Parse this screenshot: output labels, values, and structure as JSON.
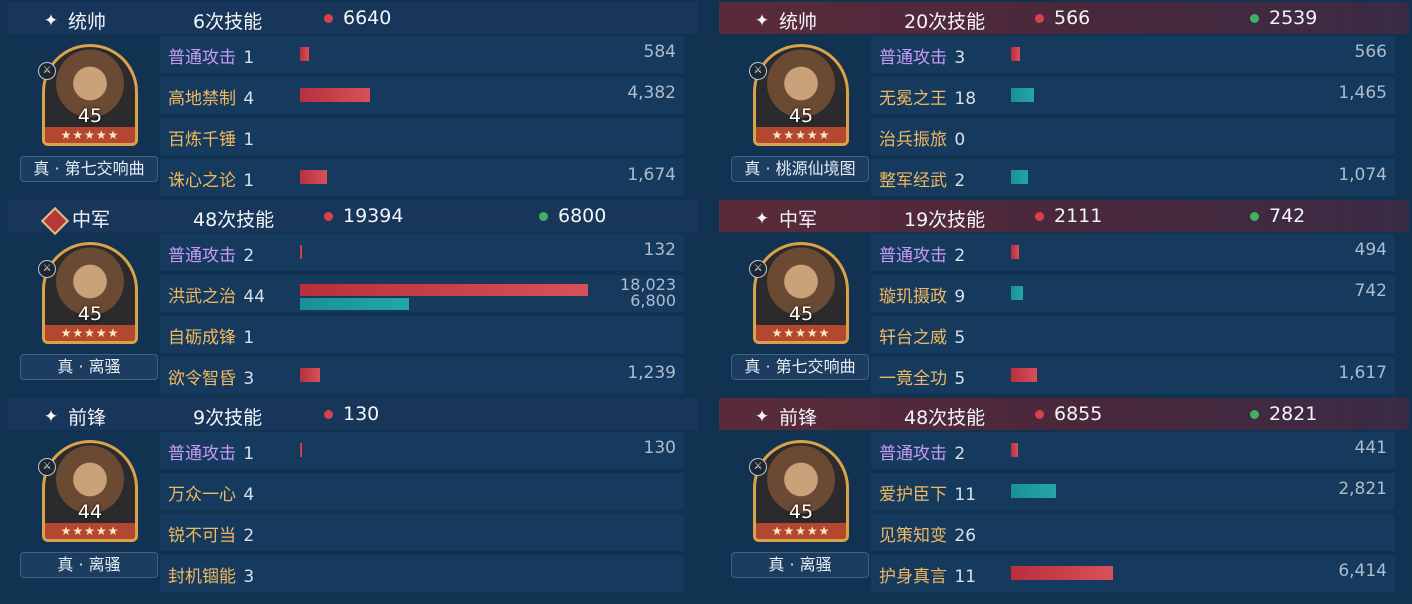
{
  "left": [
    {
      "role": "统帅",
      "role_icon": "sparkle-icon",
      "count": "6次技能",
      "damage": "6640",
      "heal": null,
      "level": "45",
      "stars": "★★★★★",
      "tactic": "真 · 第七交响曲",
      "skills": [
        {
          "name": "普通攻击",
          "level": "1",
          "basic": true,
          "dmg": 584,
          "heal": null,
          "label": "584"
        },
        {
          "name": "高地禁制",
          "level": "4",
          "basic": false,
          "dmg": 4382,
          "heal": null,
          "label": "4,382"
        },
        {
          "name": "百炼千锤",
          "level": "1",
          "basic": false,
          "dmg": null,
          "heal": null,
          "label": ""
        },
        {
          "name": "诛心之论",
          "level": "1",
          "basic": false,
          "dmg": 1674,
          "heal": null,
          "label": "1,674"
        }
      ]
    },
    {
      "role": "中军",
      "role_icon": "banner-diamond-icon",
      "count": "48次技能",
      "damage": "19394",
      "heal": "6800",
      "level": "45",
      "stars": "★★★★★",
      "tactic": "真 · 离骚",
      "skills": [
        {
          "name": "普通攻击",
          "level": "2",
          "basic": true,
          "dmg": 132,
          "heal": null,
          "label": "132"
        },
        {
          "name": "洪武之治",
          "level": "44",
          "basic": false,
          "dmg": 18023,
          "heal": 6800,
          "label": "18,023",
          "label2": "6,800"
        },
        {
          "name": "自砺成锋",
          "level": "1",
          "basic": false,
          "dmg": null,
          "heal": null,
          "label": ""
        },
        {
          "name": "欲令智昏",
          "level": "3",
          "basic": false,
          "dmg": 1239,
          "heal": null,
          "label": "1,239"
        }
      ]
    },
    {
      "role": "前锋",
      "role_icon": "sparkle-icon",
      "count": "9次技能",
      "damage": "130",
      "heal": null,
      "level": "44",
      "stars": "★★★★★",
      "tactic": "真 · 离骚",
      "skills": [
        {
          "name": "普通攻击",
          "level": "1",
          "basic": true,
          "dmg": 130,
          "heal": null,
          "label": "130"
        },
        {
          "name": "万众一心",
          "level": "4",
          "basic": false,
          "dmg": null,
          "heal": null,
          "label": ""
        },
        {
          "name": "锐不可当",
          "level": "2",
          "basic": false,
          "dmg": null,
          "heal": null,
          "label": ""
        },
        {
          "name": "封机锢能",
          "level": "3",
          "basic": false,
          "dmg": null,
          "heal": null,
          "label": ""
        }
      ]
    }
  ],
  "right": [
    {
      "role": "统帅",
      "role_icon": "sparkle-icon",
      "count": "20次技能",
      "damage": "566",
      "heal": "2539",
      "level": "45",
      "stars": "★★★★★",
      "tactic": "真 · 桃源仙境图",
      "skills": [
        {
          "name": "普通攻击",
          "level": "3",
          "basic": true,
          "dmg": 566,
          "heal": null,
          "label": "566"
        },
        {
          "name": "无冕之王",
          "level": "18",
          "basic": false,
          "dmg": null,
          "heal": 1465,
          "label": "1,465"
        },
        {
          "name": "治兵振旅",
          "level": "0",
          "basic": false,
          "dmg": null,
          "heal": null,
          "label": ""
        },
        {
          "name": "整军经武",
          "level": "2",
          "basic": false,
          "dmg": null,
          "heal": 1074,
          "label": "1,074"
        }
      ]
    },
    {
      "role": "中军",
      "role_icon": "sparkle-icon",
      "count": "19次技能",
      "damage": "2111",
      "heal": "742",
      "level": "45",
      "stars": "★★★★★",
      "tactic": "真 · 第七交响曲",
      "skills": [
        {
          "name": "普通攻击",
          "level": "2",
          "basic": true,
          "dmg": 494,
          "heal": null,
          "label": "494"
        },
        {
          "name": "璇玑摄政",
          "level": "9",
          "basic": false,
          "dmg": null,
          "heal": 742,
          "label": "742"
        },
        {
          "name": "轩台之威",
          "level": "5",
          "basic": false,
          "dmg": null,
          "heal": null,
          "label": ""
        },
        {
          "name": "一竟全功",
          "level": "5",
          "basic": false,
          "dmg": 1617,
          "heal": null,
          "label": "1,617"
        }
      ]
    },
    {
      "role": "前锋",
      "role_icon": "sparkle-icon",
      "count": "48次技能",
      "damage": "6855",
      "heal": "2821",
      "level": "45",
      "stars": "★★★★★",
      "tactic": "真 · 离骚",
      "skills": [
        {
          "name": "普通攻击",
          "level": "2",
          "basic": true,
          "dmg": 441,
          "heal": null,
          "label": "441"
        },
        {
          "name": "爱护臣下",
          "level": "11",
          "basic": false,
          "dmg": null,
          "heal": 2821,
          "label": "2,821"
        },
        {
          "name": "见策知变",
          "level": "26",
          "basic": false,
          "dmg": null,
          "heal": null,
          "label": ""
        },
        {
          "name": "护身真言",
          "level": "11",
          "basic": false,
          "dmg": 6414,
          "heal": null,
          "label": "6,414"
        }
      ]
    }
  ],
  "scale_max": 18023,
  "colors": {
    "damage": "#d8404a",
    "heal": "#3fb262",
    "bar_damage": "#c63c48",
    "bar_heal": "#20a0a4"
  }
}
